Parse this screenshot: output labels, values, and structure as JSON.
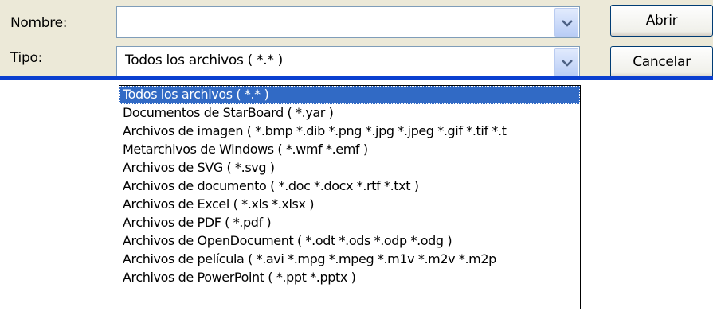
{
  "form": {
    "name_label": "Nombre:",
    "name_value": "",
    "type_label": "Tipo:",
    "type_value": "Todos los archivos ( *.* )"
  },
  "buttons": {
    "open": "Abrir",
    "cancel": "Cancelar"
  },
  "dropdown": {
    "items": [
      "Todos los archivos ( *.* )",
      "Documentos de StarBoard ( *.yar )",
      "Archivos de imagen ( *.bmp *.dib *.png *.jpg *.jpeg *.gif *.tif *.t",
      "Metarchivos de Windows ( *.wmf *.emf )",
      "Archivos de SVG ( *.svg )",
      "Archivos de documento ( *.doc *.docx *.rtf *.txt )",
      "Archivos de Excel ( *.xls *.xlsx )",
      "Archivos de PDF ( *.pdf )",
      "Archivos de OpenDocument ( *.odt *.ods *.odp *.odg )",
      "Archivos de película ( *.avi *.mpg *.mpeg *.m1v *.m2v *.m2p",
      "Archivos de PowerPoint ( *.ppt *.pptx )"
    ],
    "selected_index": 0
  },
  "icons": {
    "dropdown_arrow": "chevron-down-icon"
  },
  "colors": {
    "dialog_bg": "#ece9d8",
    "selection": "#316ac5",
    "accent_line": "#0a3fd0"
  }
}
